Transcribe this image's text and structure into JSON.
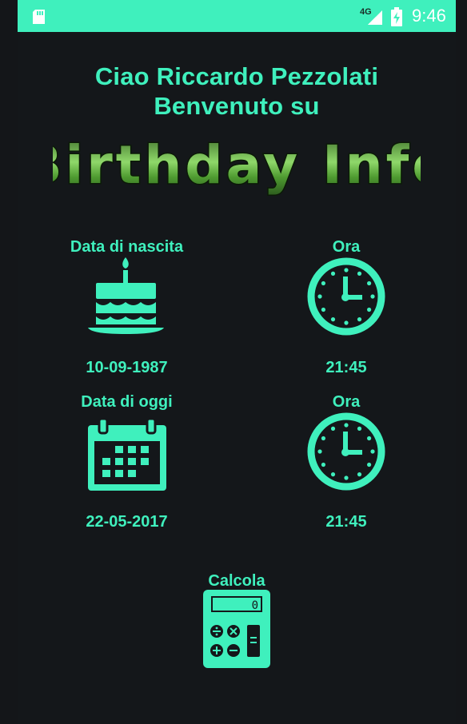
{
  "status_bar": {
    "network": "4G",
    "time": "9:46",
    "icons": [
      "sd-card-icon",
      "signal-icon",
      "battery-charging-icon"
    ]
  },
  "header": {
    "greeting_line1": "Ciao Riccardo Pezzolati",
    "greeting_line2": "Benvenuto su",
    "logo_text": "Birthday Info"
  },
  "birth": {
    "label": "Data di nascita",
    "date": "10-09-1987",
    "icon": "cake-icon",
    "time_label": "Ora",
    "time": "21:45",
    "time_icon": "clock-icon"
  },
  "today": {
    "label": "Data di oggi",
    "date": "22-05-2017",
    "icon": "calendar-icon",
    "time_label": "Ora",
    "time": "21:45",
    "time_icon": "clock-icon"
  },
  "calculate": {
    "label": "Calcola",
    "icon": "calculator-icon",
    "display_value": "0"
  },
  "colors": {
    "accent": "#3ff0bd",
    "background": "#14171a",
    "logo_green": "#5fc83a"
  }
}
